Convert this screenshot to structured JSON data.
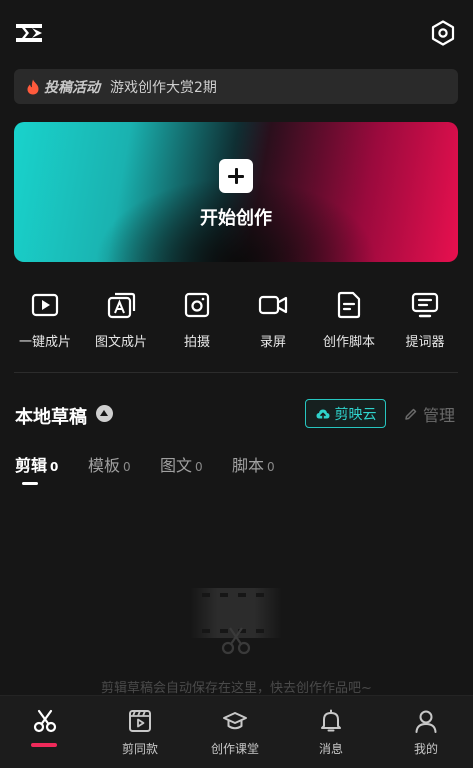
{
  "header": {
    "logo_icon": "capcut-logo-icon",
    "settings_icon": "hexagon-settings-icon"
  },
  "banner": {
    "tag": "投稿活动",
    "text": "游戏创作大赏2期",
    "icon": "flame-icon",
    "icon_color": "#ff5a3c"
  },
  "create": {
    "label": "开始创作",
    "icon": "plus-icon"
  },
  "tools": [
    {
      "label": "一键成片",
      "icon": "play-square-icon"
    },
    {
      "label": "图文成片",
      "icon": "text-to-video-icon"
    },
    {
      "label": "拍摄",
      "icon": "camera-icon"
    },
    {
      "label": "录屏",
      "icon": "video-record-icon"
    },
    {
      "label": "创作脚本",
      "icon": "script-icon"
    },
    {
      "label": "提词器",
      "icon": "teleprompter-icon"
    }
  ],
  "drafts": {
    "title": "本地草稿",
    "cloud_button": "剪映云",
    "manage": "管理",
    "accent": "#27c6c0"
  },
  "tabs": [
    {
      "name": "剪辑",
      "count": "0"
    },
    {
      "name": "模板",
      "count": "0"
    },
    {
      "name": "图文",
      "count": "0"
    },
    {
      "name": "脚本",
      "count": "0"
    }
  ],
  "empty": {
    "text": "剪辑草稿会自动保存在这里，快去创作作品吧~"
  },
  "bottom_nav": [
    {
      "label": "",
      "icon": "scissors-icon"
    },
    {
      "label": "剪同款",
      "icon": "template-clip-icon"
    },
    {
      "label": "创作课堂",
      "icon": "graduation-cap-icon"
    },
    {
      "label": "消息",
      "icon": "bell-icon"
    },
    {
      "label": "我的",
      "icon": "user-icon"
    }
  ],
  "colors": {
    "active_indicator": "#f02a5a"
  }
}
